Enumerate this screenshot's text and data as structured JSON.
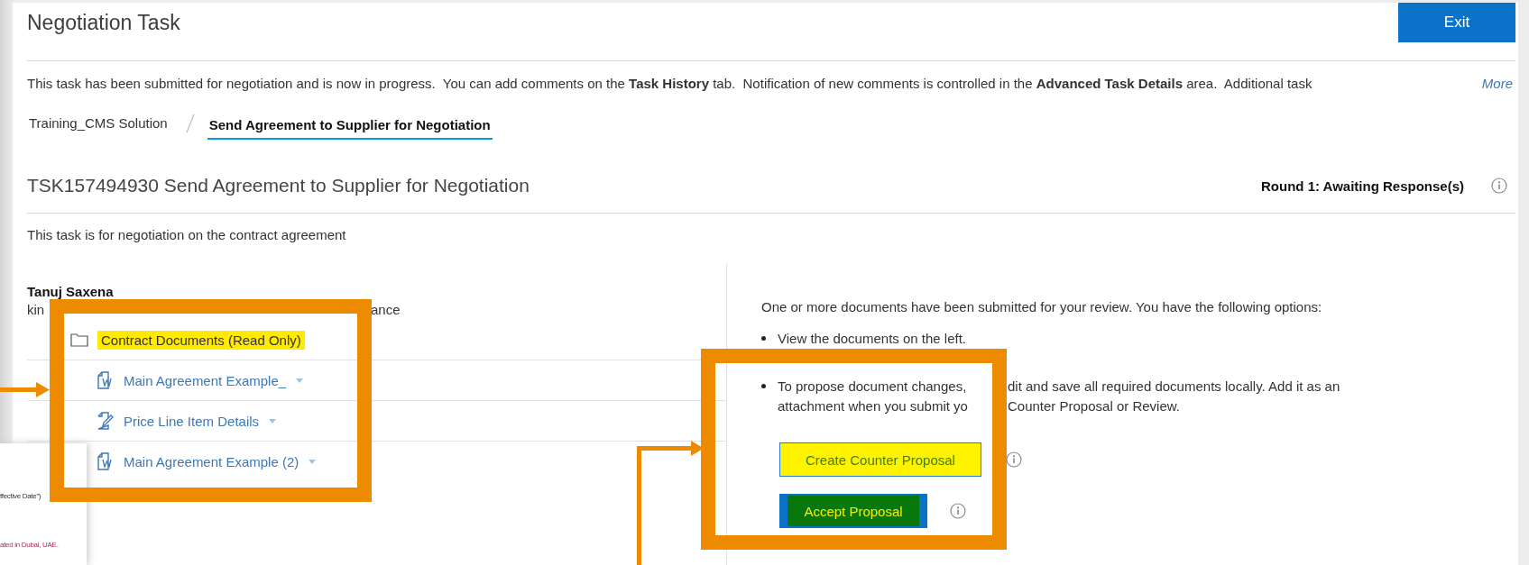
{
  "header": {
    "title": "Negotiation Task",
    "exit_button": "Exit"
  },
  "notice": {
    "text": "This task has been submitted for negotiation and is now in progress.  You can add comments on the **Task History** tab.  Notification of new comments is controlled in the **Advanced Task Details** area.  Additional task",
    "more_link": "More"
  },
  "breadcrumb": [
    {
      "label": "Training_CMS Solution",
      "selected": false
    },
    {
      "label": "Send Agreement to Supplier for Negotiation",
      "selected": true
    }
  ],
  "task": {
    "title": "TSK157494930 Send Agreement to Supplier for Negotiation",
    "status": "Round 1: Awaiting Response(s)",
    "description": "This task is for negotiation on the contract agreement"
  },
  "comment": {
    "author": "Tanuj Saxena",
    "visible_parts": [
      "kin",
      "ance"
    ]
  },
  "folder": {
    "label": "Contract Documents (Read Only)",
    "highlighted": true
  },
  "documents": [
    {
      "kind": "word",
      "name": "Main Agreement Example_"
    },
    {
      "kind": "form",
      "name": "Price Line Item Details"
    },
    {
      "kind": "word",
      "name": "Main Agreement Example (2)"
    }
  ],
  "review": {
    "intro": "One or more documents have been submitted for your review. You have the following options:",
    "bullets": [
      {
        "lines": [
          [
            "View the documents on the left."
          ]
        ]
      },
      {
        "lines": [
          [
            "To propose document changes,",
            "dit and save all required documents locally. Add it as an"
          ],
          [
            "attachment when you submit yo",
            "Counter Proposal or Review."
          ]
        ]
      }
    ]
  },
  "actions": [
    {
      "kind": "outline",
      "label": "Create Counter Proposal"
    },
    {
      "kind": "filled",
      "label": "Accept Proposal"
    }
  ],
  "thumbnail": {
    "lines": [
      {
        "kind": "plain",
        "text": "ffective Date”)"
      },
      {
        "kind": "red",
        "text": "ated in Dubai, UAE."
      }
    ]
  }
}
